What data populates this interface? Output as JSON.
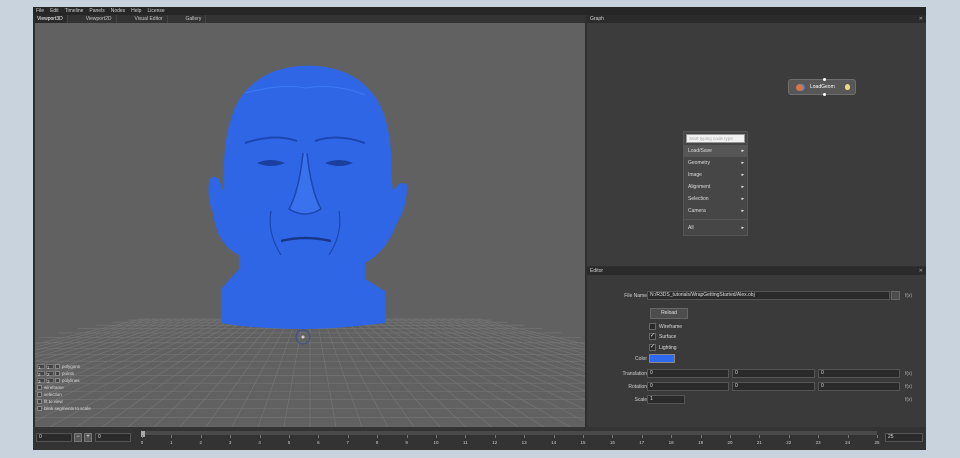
{
  "menu": [
    "File",
    "Edit",
    "Timeline",
    "Panels",
    "Nodes",
    "Help",
    "License"
  ],
  "tabs": [
    "Viewport3D",
    "Viewport2D",
    "Visual Editor",
    "Gallery"
  ],
  "viewport": {
    "options": [
      {
        "num1": "1",
        "num2": "1",
        "label": "polygons"
      },
      {
        "num1": "2",
        "num2": "2",
        "label": "points"
      },
      {
        "num1": "3",
        "num2": "3",
        "label": "polylines"
      },
      {
        "label": "wireframe"
      },
      {
        "label": "selection"
      },
      {
        "label": "fit to view"
      },
      {
        "label": "blink segments to scale"
      }
    ],
    "colors": {
      "mesh": "#2e66e6",
      "background": "#616161",
      "grid": "#777777"
    }
  },
  "graph": {
    "title": "Graph",
    "node": {
      "label": "LoadGeom"
    },
    "context_menu": {
      "search_placeholder": "Start typing node type",
      "items": [
        "Load/Save",
        "Geometry",
        "Image",
        "Alignment",
        "Selection",
        "Camera"
      ],
      "all": "All"
    }
  },
  "editor": {
    "title": "Editor",
    "file_name_label": "File Name",
    "file_name_value": "N:/R3DS_tutorials/WrapGettingStarted/Alex.obj",
    "reload_label": "Reload",
    "wireframe_label": "Wireframe",
    "wireframe_checked": false,
    "surface_label": "Surface",
    "surface_checked": true,
    "lighting_label": "Lighting",
    "lighting_checked": true,
    "color_label": "Color",
    "color_value": "#2d6af0",
    "translation_label": "Translation",
    "translation": [
      "0",
      "0",
      "0"
    ],
    "rotation_label": "Rotation",
    "rotation": [
      "0",
      "0",
      "0"
    ],
    "scale_label": "Scale",
    "scale": "1",
    "fx_label": "f(x)"
  },
  "timeline": {
    "start": "0",
    "minus": "−",
    "plus": "+",
    "current": "0",
    "end": "25",
    "ticks": [
      "0",
      "1",
      "2",
      "3",
      "4",
      "5",
      "6",
      "7",
      "8",
      "9",
      "10",
      "11",
      "12",
      "13",
      "14",
      "15",
      "16",
      "17",
      "18",
      "19",
      "20",
      "21",
      "22",
      "23",
      "24",
      "25"
    ]
  }
}
